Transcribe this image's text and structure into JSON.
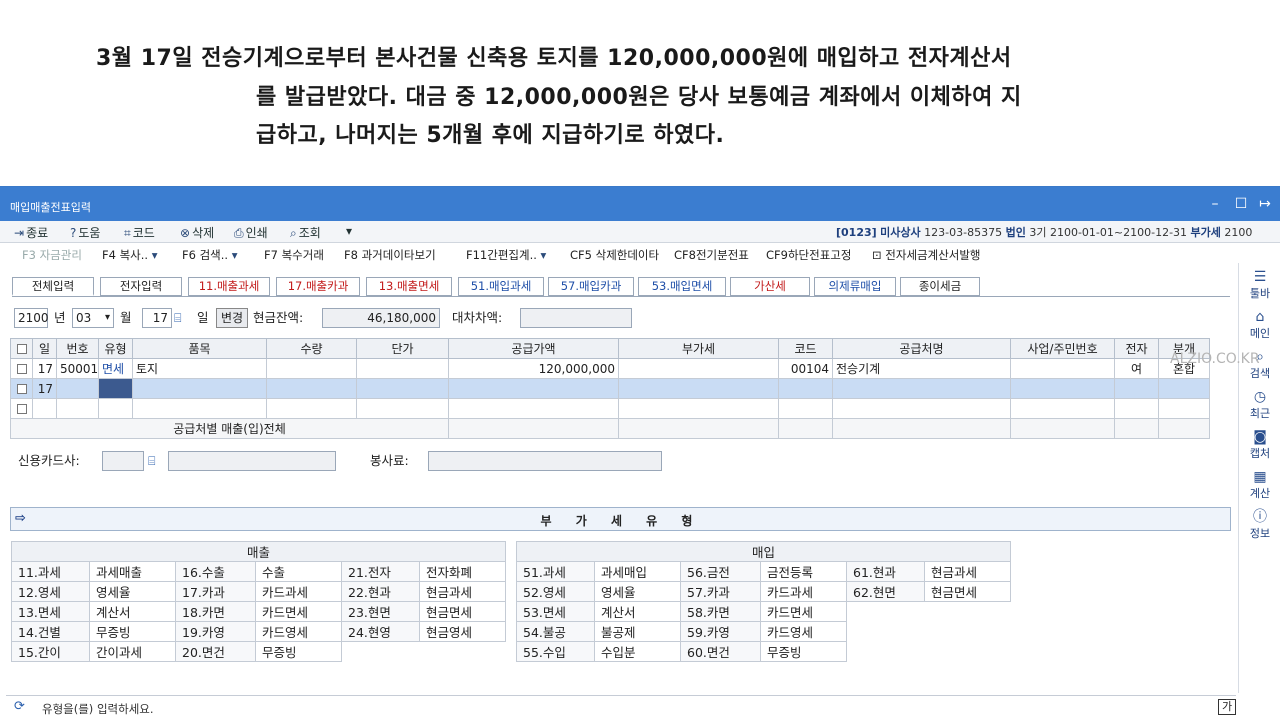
{
  "problem": {
    "line1": "3월  17일  전승기계으로부터  본사건물  신축용  토지를  120,000,000원에  매입하고  전자계산서",
    "line2": "를  발급받았다.  대금  중  12,000,000원은  당사  보통예금  계좌에서  이체하여  지",
    "line3": "급하고,  나머지는  5개월  후에  지급하기로  하였다."
  },
  "window": {
    "title": "매입매출전표입력"
  },
  "toolbar": {
    "close": "종료",
    "help": "도움",
    "code": "코드",
    "delete": "삭제",
    "print": "인쇄",
    "search": "조회",
    "company_code": "[0123]",
    "company_name": "미사상사",
    "biz_no": "123-03-85375",
    "corp": "법인",
    "period": "3기",
    "dates": "2100-01-01~2100-12-31",
    "vat_label": "부가세",
    "vat_year": "2100"
  },
  "fkeys": {
    "f3": "F3 자금관리",
    "f4": "F4 복사..",
    "f6": "F6 검색..",
    "f7": "F7 복수거래",
    "f8": "F8 과거데이타보기",
    "f11": "F11간편집계..",
    "cf5": "CF5 삭제한데이타",
    "cf8": "CF8전기분전표",
    "cf9": "CF9하단전표고정",
    "einv": "전자세금계산서발행"
  },
  "tabs": [
    "전체입력",
    "전자입력",
    "11.매출과세",
    "17.매출카과",
    "13.매출면세",
    "51.매입과세",
    "57.매입카과",
    "53.매입면세",
    "가산세",
    "의제류매입",
    "종이세금"
  ],
  "header": {
    "year": "2100",
    "year_label": "년",
    "month": "03",
    "month_label": "월",
    "day": "17",
    "day_label": "일",
    "change_btn": "변경",
    "cash_label": "현금잔액:",
    "cash_value": "46,180,000",
    "diff_label": "대차차액:",
    "diff_value": ""
  },
  "columns": [
    "일",
    "번호",
    "유형",
    "품목",
    "수량",
    "단가",
    "공급가액",
    "부가세",
    "코드",
    "공급처명",
    "사업/주민번호",
    "전자",
    "분개"
  ],
  "rows": [
    {
      "day": "17",
      "no": "50001",
      "type": "면세",
      "item": "토지",
      "qty": "",
      "price": "",
      "supply": "120,000,000",
      "vat": "",
      "code": "00104",
      "vendor": "전승기계",
      "bizno": "",
      "elec": "여",
      "entry": "혼합"
    },
    {
      "day": "17",
      "no": "",
      "type": "",
      "item": "",
      "qty": "",
      "price": "",
      "supply": "",
      "vat": "",
      "code": "",
      "vendor": "",
      "bizno": "",
      "elec": "",
      "entry": ""
    }
  ],
  "total_label": "공급처별 매출(입)전체",
  "credit": {
    "card_label": "신용카드사:",
    "service_label": "봉사료:"
  },
  "vat_title": "부 가 세 유 형",
  "sales": {
    "title": "매출",
    "cells": [
      [
        "11.과세",
        "과세매출",
        "16.수출",
        "수출",
        "21.전자",
        "전자화폐"
      ],
      [
        "12.영세",
        "영세율",
        "17.카과",
        "카드과세",
        "22.현과",
        "현금과세"
      ],
      [
        "13.면세",
        "계산서",
        "18.카면",
        "카드면세",
        "23.현면",
        "현금면세"
      ],
      [
        "14.건별",
        "무증빙",
        "19.카영",
        "카드영세",
        "24.현영",
        "현금영세"
      ],
      [
        "15.간이",
        "간이과세",
        "20.면건",
        "무증빙",
        "",
        ""
      ]
    ]
  },
  "purchase": {
    "title": "매입",
    "cells": [
      [
        "51.과세",
        "과세매입",
        "56.금전",
        "금전등록",
        "61.현과",
        "현금과세"
      ],
      [
        "52.영세",
        "영세율",
        "57.카과",
        "카드과세",
        "62.현면",
        "현금면세"
      ],
      [
        "53.면세",
        "계산서",
        "58.카면",
        "카드면세",
        "",
        ""
      ],
      [
        "54.불공",
        "불공제",
        "59.카영",
        "카드영세",
        "",
        ""
      ],
      [
        "55.수입",
        "수입분",
        "60.면건",
        "무증빙",
        "",
        ""
      ]
    ]
  },
  "status": {
    "text": "유형을(를) 입력하세요.",
    "ime": "가"
  },
  "side": {
    "menu": "툴바",
    "main": "메인",
    "search": "검색",
    "recent": "최근",
    "capture": "캡처",
    "calc": "계산",
    "info": "정보"
  },
  "watermark": "ALZIO.CO.KR"
}
